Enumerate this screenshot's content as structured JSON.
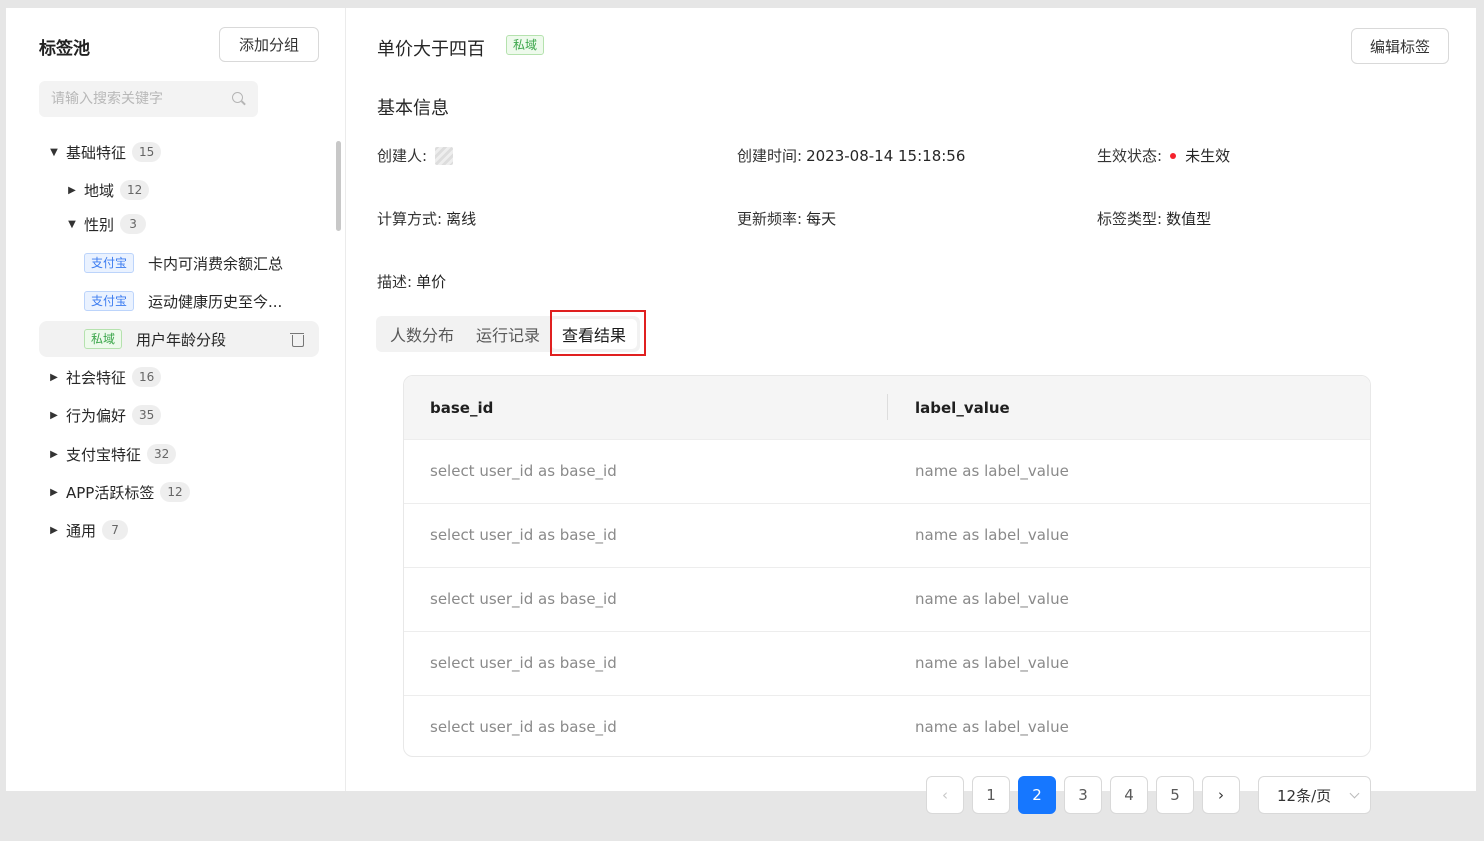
{
  "sidebar": {
    "title": "标签池",
    "add_group_label": "添加分组",
    "search_placeholder": "请输入搜索关键字",
    "groups": [
      {
        "label": "基础特征",
        "count": "15",
        "expanded": true
      },
      {
        "label": "地域",
        "count": "12",
        "expanded": false
      },
      {
        "label": "性别",
        "count": "3",
        "expanded": true
      },
      {
        "label": "社会特征",
        "count": "16",
        "expanded": false
      },
      {
        "label": "行为偏好",
        "count": "35",
        "expanded": false
      },
      {
        "label": "支付宝特征",
        "count": "32",
        "expanded": false
      },
      {
        "label": "APP活跃标签",
        "count": "12",
        "expanded": false
      },
      {
        "label": "通用",
        "count": "7",
        "expanded": false
      }
    ],
    "leaves": [
      {
        "tag": "支付宝",
        "label": "卡内可消费余额汇总"
      },
      {
        "tag": "支付宝",
        "label": "运动健康历史至今..."
      },
      {
        "tag": "私域",
        "label": "用户年龄分段"
      }
    ]
  },
  "detail": {
    "title": "单价大于四百",
    "title_tag": "私域",
    "edit_label": "编辑标签",
    "section_title": "基本信息",
    "creator_label": "创建人:",
    "created_time_label": "创建时间:",
    "created_time_value": "2023-08-14 15:18:56",
    "status_label": "生效状态:",
    "status_value": "未生效",
    "compute_label": "计算方式:",
    "compute_value": "离线",
    "frequency_label": "更新频率:",
    "frequency_value": "每天",
    "type_label": "标签类型:",
    "type_value": "数值型",
    "desc_label": "描述:",
    "desc_value": "单价",
    "status_color": "#f5222d"
  },
  "tabs": [
    "人数分布",
    "运行记录",
    "查看结果"
  ],
  "table": {
    "headers": [
      "base_id",
      "label_value"
    ],
    "rows": [
      [
        "select user_id as base_id",
        "name as label_value"
      ],
      [
        "select user_id as base_id",
        "name as label_value"
      ],
      [
        "select user_id as base_id",
        "name as label_value"
      ],
      [
        "select user_id as base_id",
        "name as label_value"
      ],
      [
        "select user_id as base_id",
        "name as label_value"
      ]
    ]
  },
  "pagination": {
    "pages": [
      "1",
      "2",
      "3",
      "4",
      "5"
    ],
    "current": "2",
    "page_size": "12条/页",
    "accent": "#1677ff"
  }
}
